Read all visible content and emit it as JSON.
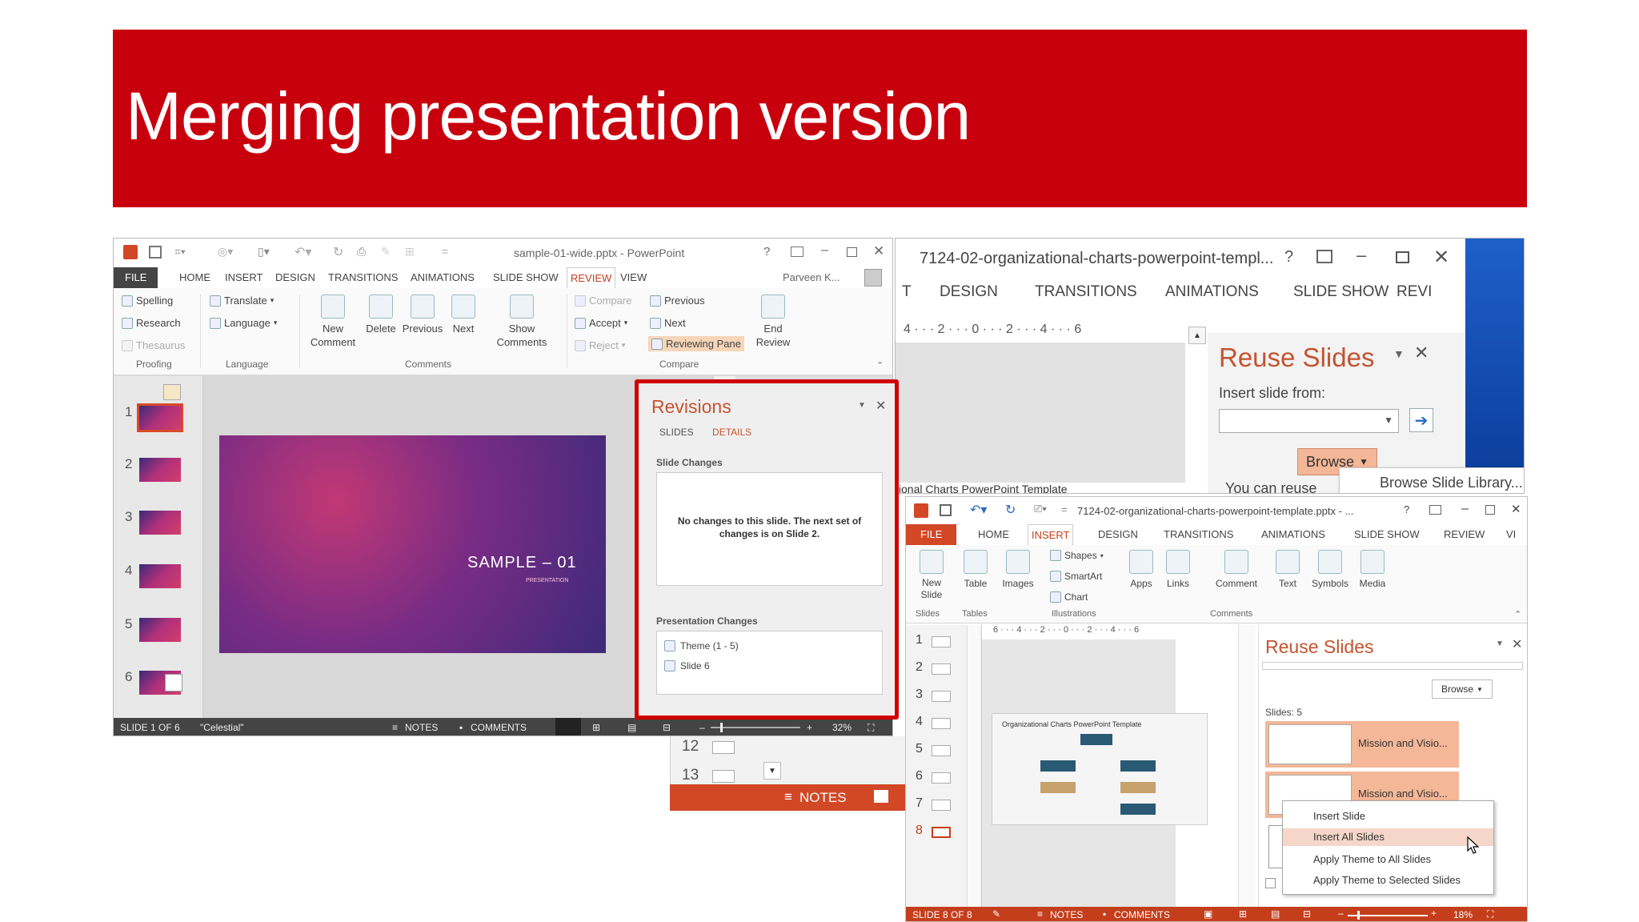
{
  "slide_title": "Merging presentation version",
  "w1": {
    "title": "sample-01-wide.pptx - PowerPoint",
    "tabs": [
      "FILE",
      "HOME",
      "INSERT",
      "DESIGN",
      "TRANSITIONS",
      "ANIMATIONS",
      "SLIDE SHOW",
      "REVIEW",
      "VIEW"
    ],
    "user": "Parveen K...",
    "proofing": [
      "Spelling",
      "Research",
      "Thesaurus"
    ],
    "language": [
      "Translate",
      "Language"
    ],
    "comments": [
      "New Comment",
      "Delete",
      "Previous",
      "Next",
      "Show Comments"
    ],
    "compare": [
      "Compare",
      "Accept",
      "Reject",
      "Previous",
      "Next",
      "Reviewing Pane",
      "End Review"
    ],
    "groups": [
      "Proofing",
      "Language",
      "Comments",
      "Compare"
    ],
    "thumbs": [
      "1",
      "2",
      "3",
      "4",
      "5",
      "6"
    ],
    "slide_main": "SAMPLE – 01",
    "slide_sub": "PRESENTATION",
    "status": {
      "slide": "SLIDE 1 OF 6",
      "theme": "\"Celestial\"",
      "notes": "NOTES",
      "comments": "COMMENTS",
      "zoom": "32%"
    }
  },
  "revisions": {
    "title": "Revisions",
    "tab_slides": "SLIDES",
    "tab_details": "DETAILS",
    "slide_changes": "Slide Changes",
    "message": "No changes to this slide. The next set of changes is on Slide 2.",
    "presentation_changes": "Presentation Changes",
    "items": [
      "Theme (1 - 5)",
      "Slide 6"
    ]
  },
  "w2": {
    "title": "7124-02-organizational-charts-powerpoint-templ...",
    "tabs": [
      "T",
      "DESIGN",
      "TRANSITIONS",
      "ANIMATIONS",
      "SLIDE SHOW",
      "REVI"
    ],
    "ruler": "4 · · · 2 · · · 0 · · · 2 · · · 4 · · · 6",
    "reuse_title": "Reuse Slides",
    "insert_from": "Insert slide from:",
    "browse": "Browse",
    "browse_lib": "Browse Slide Library...",
    "you_can": "You can reuse",
    "caption": "tional Charts PowerPoint Template"
  },
  "w3": {
    "title": "7124-02-organizational-charts-powerpoint-template.pptx - ...",
    "tabs": [
      "FILE",
      "HOME",
      "INSERT",
      "DESIGN",
      "TRANSITIONS",
      "ANIMATIONS",
      "SLIDE SHOW",
      "REVIEW",
      "VI"
    ],
    "ribbon": {
      "new_slide": "New Slide",
      "table": "Table",
      "images": "Images",
      "shapes": "Shapes",
      "smartart": "SmartArt",
      "chart": "Chart",
      "apps": "Apps",
      "links": "Links",
      "comment": "Comment",
      "text": "Text",
      "symbols": "Symbols",
      "media": "Media"
    },
    "groups": [
      "Slides",
      "Tables",
      "Illustrations",
      "Comments"
    ],
    "thumbs": [
      "1",
      "2",
      "3",
      "4",
      "5",
      "6",
      "7",
      "8"
    ],
    "ruler": "6 · · · 4 · · · 2 · · · 0 · · · 2 · · · 4 · · · 6",
    "canvas_title": "Organizational Charts PowerPoint Template",
    "reuse_title": "Reuse Slides",
    "browse": "Browse",
    "slides_count": "Slides: 5",
    "reuse_items": [
      "Mission and Visio...",
      "Mission and Visio..."
    ],
    "status": {
      "slide": "SLIDE 8 OF 8",
      "notes": "NOTES",
      "comments": "COMMENTS",
      "zoom": "18%"
    }
  },
  "context_menu": [
    "Insert Slide",
    "Insert All Slides",
    "Apply Theme to All Slides",
    "Apply Theme to Selected Slides"
  ],
  "strip": {
    "n12": "12",
    "n13": "13",
    "notes": "NOTES"
  },
  "colors": {
    "banner": "#c8000d",
    "accent": "#c43e1c",
    "highlight_border": "#d10000"
  }
}
